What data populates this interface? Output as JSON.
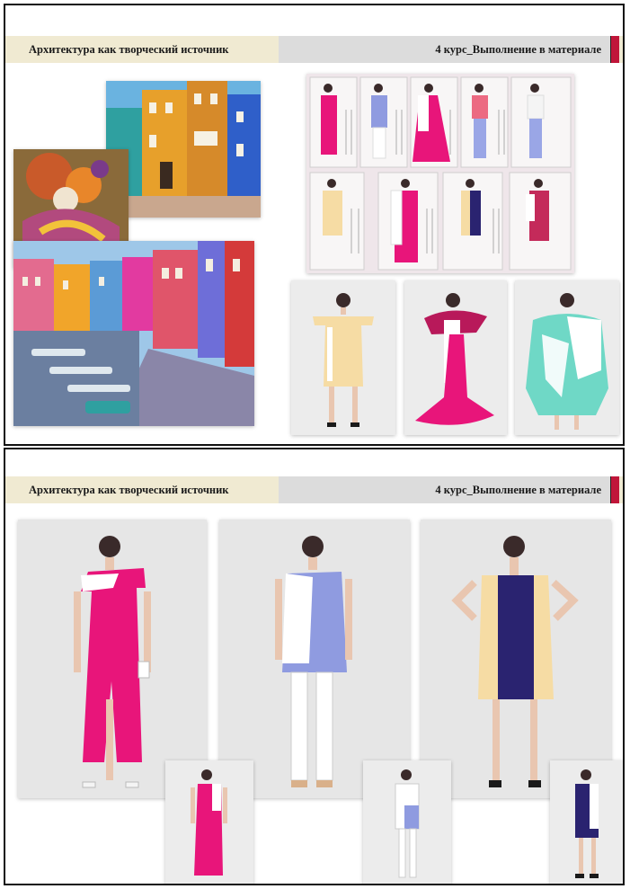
{
  "slides": [
    {
      "header": {
        "left_title": "Архитектура  как творческий  источник",
        "right_title": "4 курс_Выполнение в материале"
      }
    },
    {
      "header": {
        "left_title": "Архитектура  как творческий  источник",
        "right_title": "4 курс_Выполнение в материале"
      }
    }
  ],
  "images": {
    "slide1": [
      "colorful-houses-photo",
      "carnival-costume-photo",
      "canal-houses-photo",
      "collection-sketches-collage",
      "yellow-dress-photo",
      "pink-gown-photo",
      "mint-dress-photo"
    ],
    "slide2": [
      "pink-dress-large-photo",
      "blue-dress-large-photo",
      "navy-dress-large-photo",
      "pink-dress-small-photo",
      "blue-dress-small-photo",
      "navy-dress-small-photo"
    ]
  },
  "colors": {
    "header_beige": "#f0ead2",
    "header_gray": "#dcdcdc",
    "accent_red": "#c0163a",
    "fuchsia": "#e8157a",
    "periwinkle": "#8f9be0",
    "navy": "#2a2370",
    "butter": "#f6dca4",
    "mint": "#6fd8c6"
  }
}
